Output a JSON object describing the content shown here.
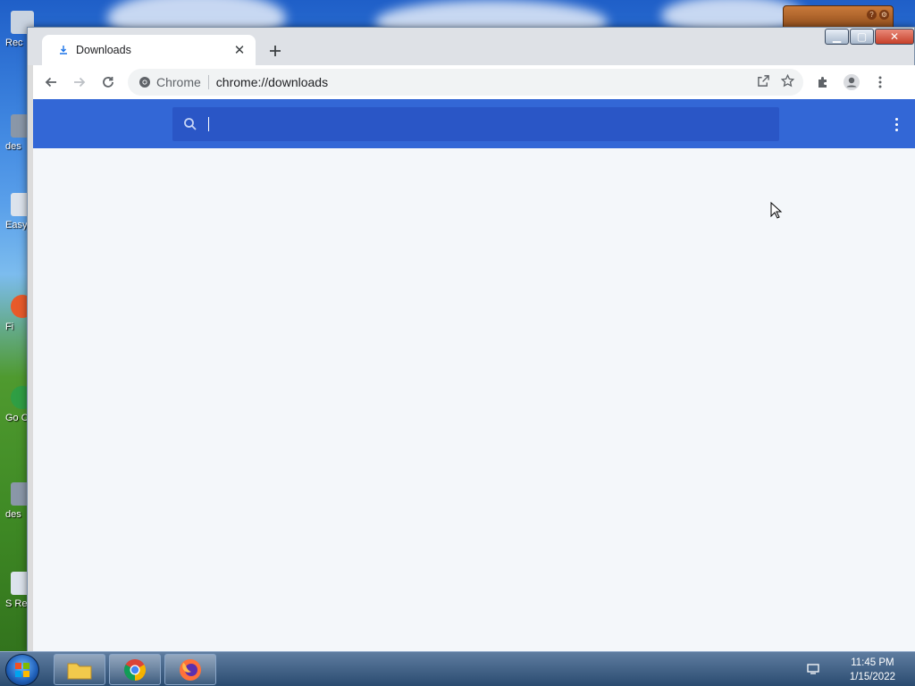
{
  "desktop": {
    "icons": [
      {
        "label": "Rec",
        "color": "#c9d3e0"
      },
      {
        "label": "des",
        "color": "#8a97a8"
      },
      {
        "label": "Easy",
        "color": "#dce3ec"
      },
      {
        "label": "Fi",
        "color": "#e85a2a"
      },
      {
        "label": "Go Ch",
        "color": "#2f9e44"
      },
      {
        "label": "des",
        "color": "#8a97a8"
      },
      {
        "label": "S Rep",
        "color": "#dce3ec"
      }
    ]
  },
  "window": {
    "tab": {
      "title": "Downloads",
      "favicon": "download-icon"
    },
    "new_tab_icon": "plus-icon",
    "toolbar": {
      "back_icon": "arrow-left-icon",
      "forward_icon": "arrow-right-icon",
      "reload_icon": "reload-icon",
      "site_name": "Chrome",
      "url": "chrome://downloads",
      "share_icon": "share-icon",
      "bookmark_icon": "star-icon",
      "extensions_icon": "puzzle-icon",
      "profile_icon": "profile-icon",
      "menu_icon": "kebab-menu-icon"
    },
    "downloads_page": {
      "search_placeholder": "",
      "search_value": "",
      "header_color": "#3367d6",
      "search_bg": "#2a56c6",
      "background": "#f4f7fa"
    }
  },
  "taskbar": {
    "items": [
      {
        "name": "file-explorer",
        "icon": "folder-icon"
      },
      {
        "name": "chrome",
        "icon": "chrome-icon"
      },
      {
        "name": "firefox",
        "icon": "firefox-icon"
      }
    ],
    "clock": {
      "time": "11:45 PM",
      "date": "1/15/2022"
    }
  }
}
